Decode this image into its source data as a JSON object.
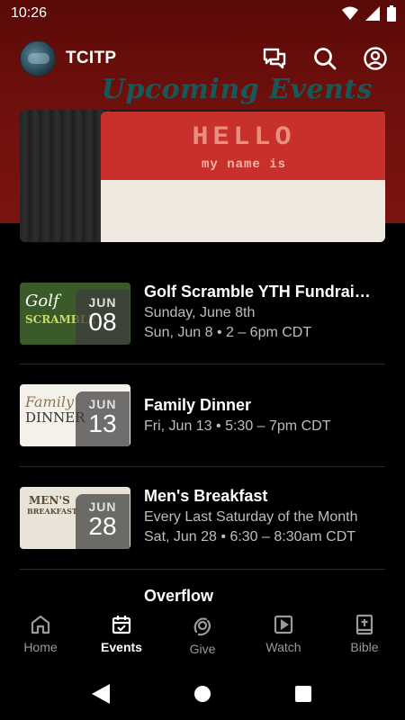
{
  "status": {
    "time": "10:26"
  },
  "app": {
    "title": "TCITP"
  },
  "banner": {
    "hello": "HELLO",
    "my_name_is": "my name is",
    "caption": "Upcoming Events"
  },
  "events": [
    {
      "title": "Golf Scramble YTH Fundrai…",
      "line1": "Sunday, June 8th",
      "line2": "Sun, Jun 8 • 2 – 6pm CDT",
      "month": "JUN",
      "day": "08",
      "thumb_text": "Golf",
      "thumb_text2": "SCRAMBLE",
      "thumb_bg": "#3b5a2a"
    },
    {
      "title": "Family Dinner",
      "line1": "Fri, Jun 13 • 5:30 – 7pm CDT",
      "month": "JUN",
      "day": "13",
      "thumb_text": "Family",
      "thumb_text2": "DINNER",
      "thumb_bg": "#f4f1ea"
    },
    {
      "title": "Men's Breakfast",
      "line1": "Every Last Saturday of the Month",
      "line2": "Sat, Jun 28 • 6:30 – 8:30am CDT",
      "month": "JUN",
      "day": "28",
      "thumb_text": "MEN'S",
      "thumb_text2": "BREAKFAST",
      "thumb_bg": "#e9e3d8"
    }
  ],
  "overflow_title": "Overflow",
  "nav": {
    "items": [
      {
        "label": "Home",
        "icon": "home-icon"
      },
      {
        "label": "Events",
        "icon": "calendar-icon",
        "active": true
      },
      {
        "label": "Give",
        "icon": "give-icon"
      },
      {
        "label": "Watch",
        "icon": "play-icon"
      },
      {
        "label": "Bible",
        "icon": "bible-icon"
      }
    ]
  },
  "colors": {
    "header_red": "#6e100c",
    "background": "#000000",
    "inactive_nav": "#9a9a9a"
  }
}
